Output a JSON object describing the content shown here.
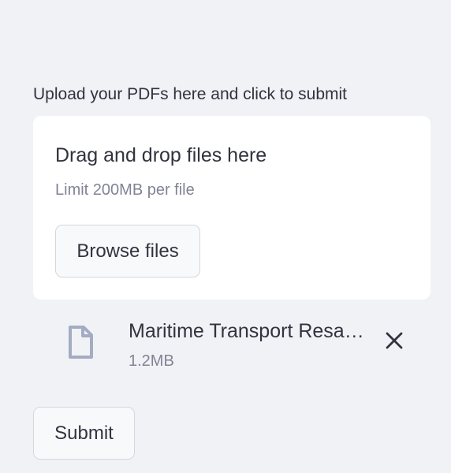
{
  "uploader": {
    "label": "Upload your PDFs here and click to submit",
    "dropzone_title": "Drag and drop files here",
    "dropzone_limit": "Limit 200MB per file",
    "browse_label": "Browse files"
  },
  "file": {
    "name": "Maritime Transport Resa…",
    "size": "1.2MB",
    "icon": "file-icon",
    "remove_icon": "close-icon"
  },
  "submit_label": "Submit",
  "colors": {
    "background": "#f0f2f6",
    "card": "#ffffff",
    "text": "#31333f",
    "muted_text": "#808495",
    "icon": "#a3acc2"
  }
}
